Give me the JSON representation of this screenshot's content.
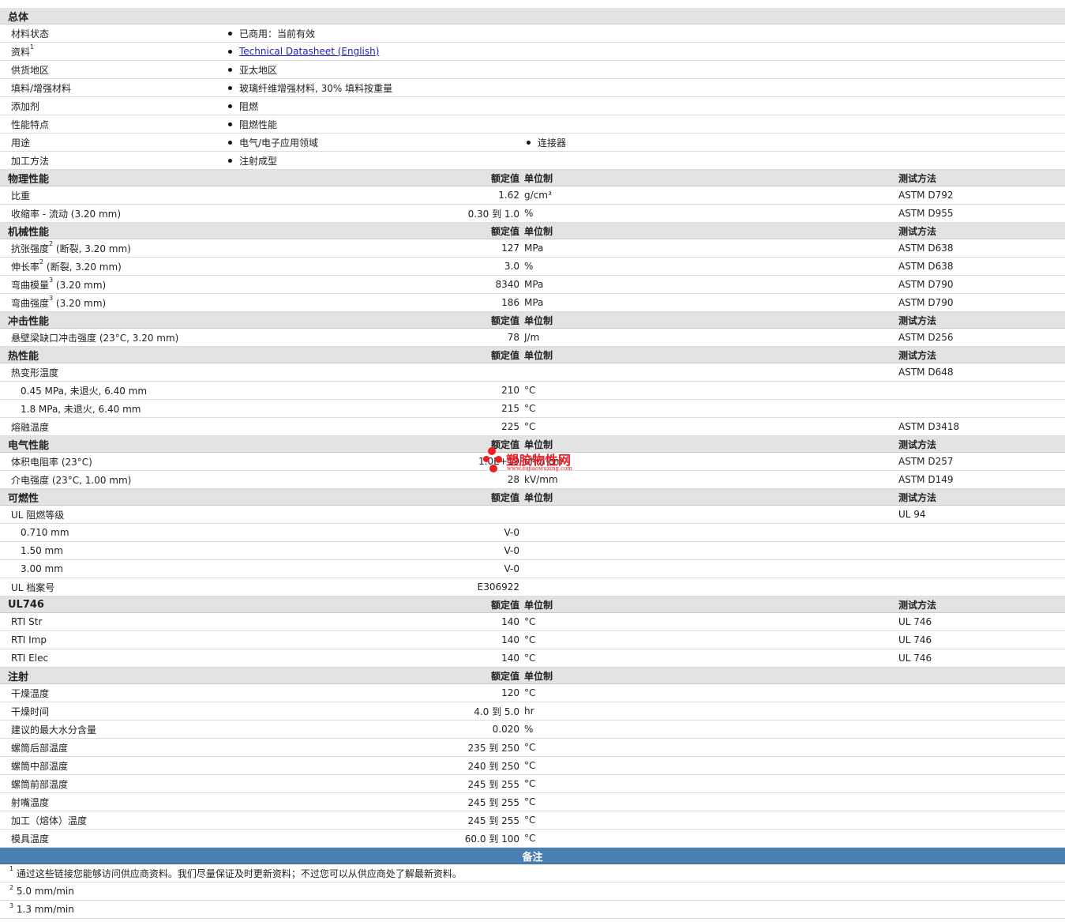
{
  "general": {
    "title": "总体",
    "rows": [
      {
        "label": "材料状态",
        "values": [
          "已商用：当前有效"
        ]
      },
      {
        "label": "资料",
        "sup": "1",
        "values": [
          "Technical Datasheet (English)"
        ]
      },
      {
        "label": "供货地区",
        "values": [
          "亚太地区"
        ]
      },
      {
        "label": "填料/增强材料",
        "values": [
          "玻璃纤维增强材料, 30% 填料按重量"
        ]
      },
      {
        "label": "添加剂",
        "values": [
          "阻燃"
        ]
      },
      {
        "label": "性能特点",
        "values": [
          "阻燃性能"
        ]
      },
      {
        "label": "用途",
        "values": [
          "电气/电子应用领域",
          "连接器"
        ]
      },
      {
        "label": "加工方法",
        "values": [
          "注射成型"
        ]
      }
    ]
  },
  "headers": {
    "value": "额定值",
    "unit": "单位制",
    "method": "测试方法"
  },
  "sections": [
    {
      "title": "物理性能",
      "has_method": true,
      "rows": [
        {
          "label": "比重",
          "value": "1.62",
          "unit": "g/cm³",
          "method": "ASTM D792"
        },
        {
          "label": "收缩率 - 流动 (3.20 mm)",
          "value": "0.30 到  1.0",
          "unit": "%",
          "method": "ASTM D955"
        }
      ]
    },
    {
      "title": "机械性能",
      "has_method": true,
      "rows": [
        {
          "label": "抗张强度",
          "sup": "2",
          "label_suffix": " (断裂, 3.20 mm)",
          "value": "127",
          "unit": "MPa",
          "method": "ASTM D638"
        },
        {
          "label": "伸长率",
          "sup": "2",
          "label_suffix": " (断裂, 3.20 mm)",
          "value": "3.0",
          "unit": "%",
          "method": "ASTM D638"
        },
        {
          "label": "弯曲模量",
          "sup": "3",
          "label_suffix": " (3.20 mm)",
          "value": "8340",
          "unit": "MPa",
          "method": "ASTM D790"
        },
        {
          "label": "弯曲强度",
          "sup": "3",
          "label_suffix": " (3.20 mm)",
          "value": "186",
          "unit": "MPa",
          "method": "ASTM D790"
        }
      ]
    },
    {
      "title": "冲击性能",
      "has_method": true,
      "rows": [
        {
          "label": "悬壁梁缺口冲击强度 (23°C, 3.20 mm)",
          "value": "78",
          "unit": "J/m",
          "method": "ASTM D256"
        }
      ]
    },
    {
      "title": "热性能",
      "has_method": true,
      "rows": [
        {
          "label": "热变形温度",
          "value": "",
          "unit": "",
          "method": "ASTM D648"
        },
        {
          "label": "0.45 MPa, 未退火, 6.40 mm",
          "sub": true,
          "value": "210",
          "unit": "°C",
          "method": ""
        },
        {
          "label": "1.8 MPa, 未退火, 6.40 mm",
          "sub": true,
          "value": "215",
          "unit": "°C",
          "method": ""
        },
        {
          "label": "熔融温度",
          "value": "225",
          "unit": "°C",
          "method": "ASTM D3418"
        }
      ]
    },
    {
      "title": "电气性能",
      "has_method": true,
      "rows": [
        {
          "label": "体积电阻率 (23°C)",
          "value": "1.0E+19",
          "unit": "ohm·cm",
          "method": "ASTM D257"
        },
        {
          "label": "介电强度 (23°C, 1.00 mm)",
          "value": "28",
          "unit": "kV/mm",
          "method": "ASTM D149"
        }
      ]
    },
    {
      "title": "可燃性",
      "has_method": true,
      "rows": [
        {
          "label": "UL 阻燃等级",
          "value": "",
          "unit": "",
          "method": "UL 94"
        },
        {
          "label": "0.710 mm",
          "sub": true,
          "value": "V-0",
          "unit": "",
          "method": ""
        },
        {
          "label": "1.50 mm",
          "sub": true,
          "value": "V-0",
          "unit": "",
          "method": ""
        },
        {
          "label": "3.00 mm",
          "sub": true,
          "value": "V-0",
          "unit": "",
          "method": ""
        },
        {
          "label": "UL 档案号",
          "value": "E306922",
          "unit": "",
          "method": ""
        }
      ]
    },
    {
      "title": "UL746",
      "has_method": true,
      "rows": [
        {
          "label": "RTI Str",
          "value": "140",
          "unit": "°C",
          "method": "UL 746"
        },
        {
          "label": "RTI Imp",
          "value": "140",
          "unit": "°C",
          "method": "UL 746"
        },
        {
          "label": "RTI Elec",
          "value": "140",
          "unit": "°C",
          "method": "UL 746"
        }
      ]
    },
    {
      "title": "注射",
      "has_method": false,
      "rows": [
        {
          "label": "干燥温度",
          "value": "120",
          "unit": "°C",
          "method": ""
        },
        {
          "label": "干燥时间",
          "value": "4.0 到  5.0",
          "unit": "hr",
          "method": ""
        },
        {
          "label": "建议的最大水分含量",
          "value": "0.020",
          "unit": "%",
          "method": ""
        },
        {
          "label": "螺筒后部温度",
          "value": "235 到  250",
          "unit": "°C",
          "method": ""
        },
        {
          "label": "螺筒中部温度",
          "value": "240 到  250",
          "unit": "°C",
          "method": ""
        },
        {
          "label": "螺筒前部温度",
          "value": "245 到  255",
          "unit": "°C",
          "method": ""
        },
        {
          "label": "射嘴温度",
          "value": "245 到  255",
          "unit": "°C",
          "method": ""
        },
        {
          "label": "加工（熔体）温度",
          "value": "245 到  255",
          "unit": "°C",
          "method": ""
        },
        {
          "label": "模具温度",
          "value": "60.0 到  100",
          "unit": "°C",
          "method": ""
        }
      ]
    }
  ],
  "notes": {
    "title": "备注",
    "items": [
      {
        "num": "1",
        "text": "通过这些链接您能够访问供应商资料。我们尽量保证及时更新资料；不过您可以从供应商处了解最新资料。"
      },
      {
        "num": "2",
        "text": "5.0 mm/min"
      },
      {
        "num": "3",
        "text": "1.3 mm/min"
      }
    ]
  },
  "watermark": {
    "title": "塑胶物性网",
    "url": "www.sujiaowuxing.com",
    "color": "#ee1c25"
  }
}
